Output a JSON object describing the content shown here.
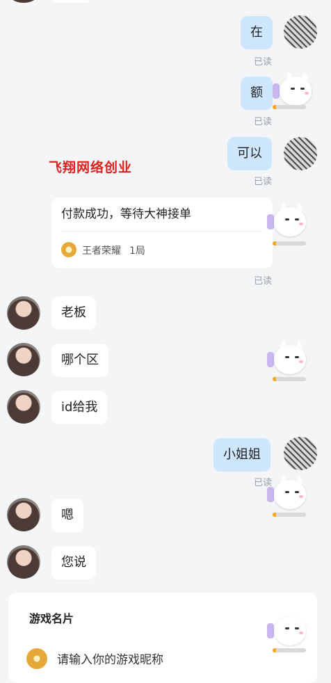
{
  "watermark": "飞翔网络创业",
  "read_label": "已读",
  "messages": [
    {
      "side": "right",
      "text": "在"
    },
    {
      "side": "right",
      "text": "额"
    },
    {
      "side": "right",
      "text": "可以"
    },
    {
      "side": "left",
      "text": "老板"
    },
    {
      "side": "left",
      "text": "哪个区"
    },
    {
      "side": "left",
      "text": "id给我"
    },
    {
      "side": "right",
      "text": "小姐姐"
    },
    {
      "side": "left",
      "text": "嗯"
    },
    {
      "side": "left",
      "text": "您说"
    }
  ],
  "order_card": {
    "title": "付款成功，等待大神接单",
    "game": "王者荣耀",
    "count": "1局"
  },
  "game_card": {
    "label": "游戏名片",
    "placeholder": "请输入你的游戏昵称"
  },
  "progress_fraction": 0.1,
  "colors": {
    "bubble_right": "#cfe6ff",
    "bubble_left": "#ffffff",
    "background": "#f4f5f7",
    "watermark": "#e0201f",
    "progress": "#f5a623"
  }
}
